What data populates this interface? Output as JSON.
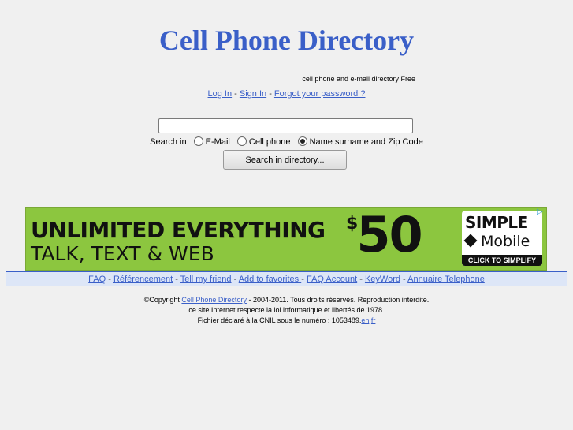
{
  "header": {
    "title": "Cell Phone Directory",
    "tagline": "cell phone and e-mail directory Free"
  },
  "auth": {
    "login": "Log In",
    "signin": "Sign In",
    "forgot": "Forgot your password ?"
  },
  "search": {
    "input_value": "",
    "label": "Search in",
    "options": [
      {
        "label": "E-Mail",
        "checked": false
      },
      {
        "label": "Cell phone",
        "checked": false
      },
      {
        "label": "Name surname and Zip Code",
        "checked": true
      }
    ],
    "button": "Search in directory..."
  },
  "ad": {
    "line1": "UNLIMITED EVERYTHING",
    "line2": "TALK, TEXT & WEB",
    "currency": "$",
    "price": "50",
    "brand": "SIMPLE",
    "brand_sub": "Mobile",
    "cta": "CLICK TO SIMPLIFY",
    "bg_color": "#8cc63f"
  },
  "footer_nav": {
    "items": [
      "FAQ",
      "Référencement",
      "Tell my friend",
      "Add to favorites ",
      "FAQ Account",
      "KeyWord",
      "Annuaire Telephone"
    ]
  },
  "copyright": {
    "prefix": "©Copyright ",
    "link": "Cell Phone Directory",
    "suffix": " - 2004-2011. Tous droits réservés. Reproduction interdite.",
    "line2": "ce site Internet respecte la loi informatique et libertés de 1978.",
    "line3": "Fichier déclaré à la CNIL sous le numéro : 1053489.",
    "lang_en": "en",
    "lang_fr": "fr"
  },
  "colors": {
    "link": "#3a5fc8",
    "nav_bg": "#dde6f7",
    "page_bg": "#f0f0f0"
  }
}
